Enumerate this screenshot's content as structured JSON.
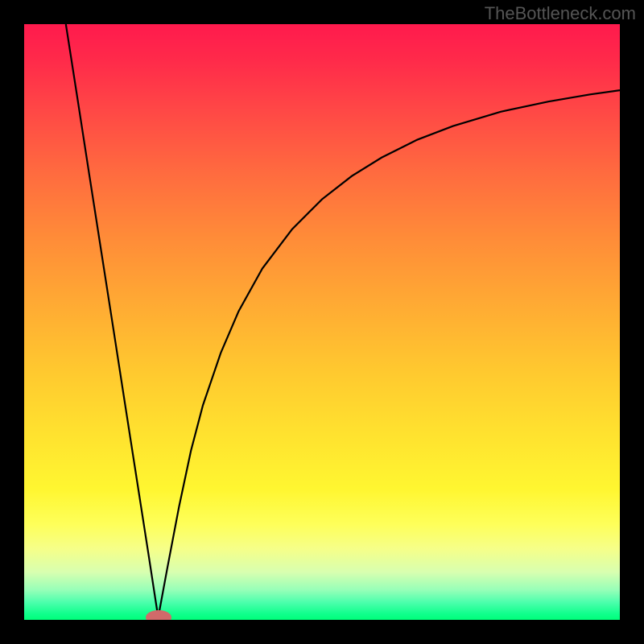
{
  "watermark": "TheBottleneck.com",
  "colors": {
    "background": "#000000",
    "curve": "#000000",
    "marker": "#d16a6a"
  },
  "chart_data": {
    "type": "line",
    "title": "",
    "xlabel": "",
    "ylabel": "",
    "xlim": [
      0,
      100
    ],
    "ylim": [
      0,
      100
    ],
    "grid": false,
    "series": [
      {
        "name": "left-segment",
        "x": [
          7,
          9,
          11,
          13,
          15,
          17,
          19,
          21,
          22.5
        ],
        "values": [
          100,
          87.2,
          74.3,
          61.5,
          48.7,
          35.8,
          23.0,
          10.2,
          0.4
        ]
      },
      {
        "name": "right-segment",
        "x": [
          22.5,
          24,
          26,
          28,
          30,
          33,
          36,
          40,
          45,
          50,
          55,
          60,
          66,
          72,
          80,
          88,
          95,
          100
        ],
        "values": [
          0.4,
          8.5,
          19.0,
          28.4,
          36.0,
          44.8,
          51.8,
          59.0,
          65.6,
          70.6,
          74.5,
          77.6,
          80.6,
          82.9,
          85.3,
          87.0,
          88.2,
          88.9
        ]
      }
    ],
    "marker": {
      "x": 22.5,
      "y": 0.4
    },
    "gradient_stops": [
      {
        "pos": 0.0,
        "color": "#ff1a4d"
      },
      {
        "pos": 0.5,
        "color": "#ffb030"
      },
      {
        "pos": 0.8,
        "color": "#ffff40"
      },
      {
        "pos": 1.0,
        "color": "#00ff7a"
      }
    ]
  }
}
